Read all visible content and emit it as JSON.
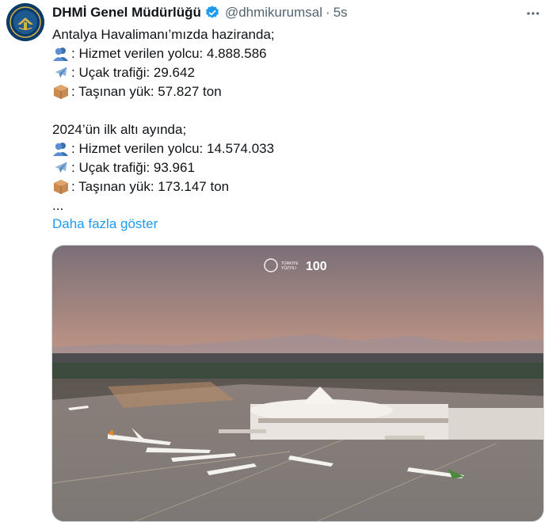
{
  "author": {
    "name": "DHMİ Genel Müdürlüğü",
    "handle": "@dhmikurumsal",
    "separator": "·",
    "time": "5s",
    "verified_color": "#1d9bf0"
  },
  "tweet": {
    "lines_first": [
      {
        "text": "Antalya Havalimanı’mızda haziranda;",
        "icon": ""
      },
      {
        "text": ": Hizmet verilen yolcu: 4.888.586",
        "icon": "people-icon"
      },
      {
        "text": ": Uçak trafiği: 29.642",
        "icon": "airplane-icon"
      },
      {
        "text": ": Taşınan yük: 57.827 ton",
        "icon": "package-icon"
      }
    ],
    "lines_second": [
      {
        "text": "2024’ün ilk altı ayında;",
        "icon": ""
      },
      {
        "text": ": Hizmet verilen yolcu: 14.574.033",
        "icon": "people-icon"
      },
      {
        "text": ": Uçak trafiği: 93.961",
        "icon": "airplane-icon"
      },
      {
        "text": ": Taşınan yük: 173.147 ton",
        "icon": "package-icon"
      }
    ],
    "ellipsis": "...",
    "show_more": "Daha fazla göster"
  },
  "media": {
    "description_icon": "airport-aerial-photo",
    "watermark_left": "TÜRKİYE YÜZYILI",
    "watermark_right": "100"
  },
  "colors": {
    "link": "#1d9bf0",
    "secondary_text": "#536471"
  }
}
